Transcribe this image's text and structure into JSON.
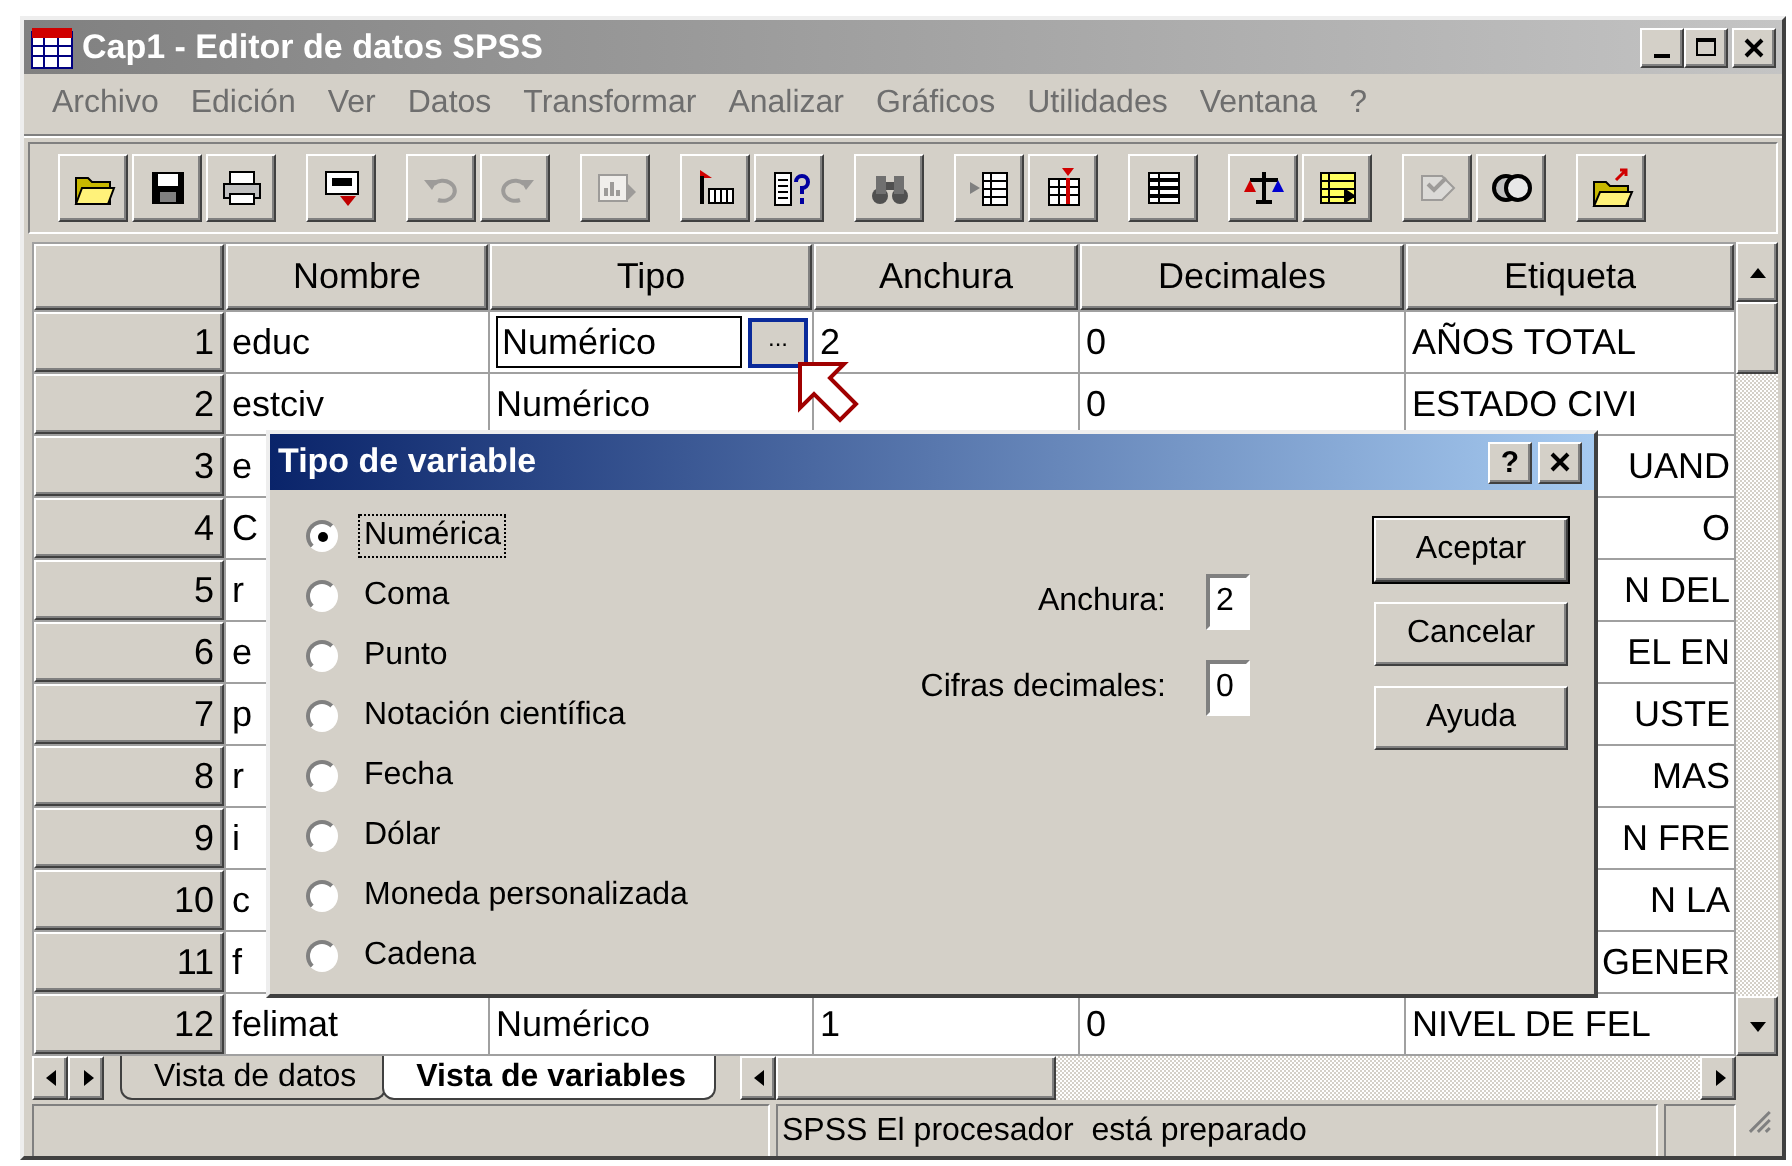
{
  "window": {
    "title": "Cap1 - Editor de datos SPSS"
  },
  "menu": [
    {
      "label": "Archivo"
    },
    {
      "label": "Edición"
    },
    {
      "label": "Ver"
    },
    {
      "label": "Datos"
    },
    {
      "label": "Transformar"
    },
    {
      "label": "Analizar"
    },
    {
      "label": "Gráficos"
    },
    {
      "label": "Utilidades"
    },
    {
      "label": "Ventana"
    },
    {
      "label": "?"
    }
  ],
  "toolbar": [
    [
      {
        "kind": "open",
        "disabled": false
      },
      {
        "kind": "save",
        "disabled": false
      },
      {
        "kind": "print",
        "disabled": false
      }
    ],
    [
      {
        "kind": "recall",
        "disabled": false
      }
    ],
    [
      {
        "kind": "undo",
        "disabled": true
      },
      {
        "kind": "redo",
        "disabled": true
      }
    ],
    [
      {
        "kind": "chart",
        "disabled": true
      }
    ],
    [
      {
        "kind": "gotocase",
        "disabled": false
      },
      {
        "kind": "varinfo",
        "disabled": false
      }
    ],
    [
      {
        "kind": "find",
        "disabled": false
      }
    ],
    [
      {
        "kind": "insertcase",
        "disabled": false
      },
      {
        "kind": "insertvar",
        "disabled": false
      }
    ],
    [
      {
        "kind": "split",
        "disabled": false
      }
    ],
    [
      {
        "kind": "weight",
        "disabled": false
      },
      {
        "kind": "select",
        "disabled": false
      }
    ],
    [
      {
        "kind": "labels",
        "disabled": true
      },
      {
        "kind": "sets",
        "disabled": false
      }
    ],
    [
      {
        "kind": "up",
        "disabled": false
      }
    ]
  ],
  "grid": {
    "columns": [
      "Nombre",
      "Tipo",
      "Anchura",
      "Decimales",
      "Etiqueta"
    ],
    "rows": [
      {
        "kind": "full",
        "number": "1",
        "nombre": "educ",
        "tipo": "Numérico",
        "editing": true,
        "editor_button": "...",
        "anchura": "2",
        "decimales": "0",
        "etiqueta": "AÑOS TOTAL"
      },
      {
        "kind": "full",
        "number": "2",
        "nombre": "estciv",
        "tipo": "Numérico",
        "editing": false,
        "decimales": "0",
        "etiqueta": "ESTADO CIVI"
      },
      {
        "kind": "covered",
        "number": "3",
        "nombre": "e",
        "etiqueta": "UAND"
      },
      {
        "kind": "covered",
        "number": "4",
        "nombre": "C",
        "etiqueta": "O"
      },
      {
        "kind": "covered",
        "number": "5",
        "nombre": "r",
        "etiqueta": "N DEL"
      },
      {
        "kind": "covered",
        "number": "6",
        "nombre": "e",
        "etiqueta": "EL EN"
      },
      {
        "kind": "covered",
        "number": "7",
        "nombre": "p",
        "etiqueta": "USTE"
      },
      {
        "kind": "covered",
        "number": "8",
        "nombre": "r",
        "etiqueta": "MAS"
      },
      {
        "kind": "covered",
        "number": "9",
        "nombre": "i",
        "etiqueta": "N FRE"
      },
      {
        "kind": "covered",
        "number": "10",
        "nombre": "c",
        "etiqueta": "N LA"
      },
      {
        "kind": "covered",
        "number": "11",
        "nombre": "f",
        "etiqueta": "GENER"
      },
      {
        "kind": "full",
        "number": "12",
        "nombre": "felimat",
        "tipo": "Numérico",
        "editing": false,
        "anchura": "1",
        "decimales": "0",
        "etiqueta": "NIVEL DE FEL"
      }
    ]
  },
  "dialog": {
    "title": "Tipo de variable",
    "help": "?",
    "options": [
      {
        "label": "Numérica",
        "selected": true,
        "focused": true
      },
      {
        "label": "Coma",
        "selected": false,
        "focused": false
      },
      {
        "label": "Punto",
        "selected": false,
        "focused": false
      },
      {
        "label": "Notación científica",
        "selected": false,
        "focused": false
      },
      {
        "label": "Fecha",
        "selected": false,
        "focused": false
      },
      {
        "label": "Dólar",
        "selected": false,
        "focused": false
      },
      {
        "label": "Moneda personalizada",
        "selected": false,
        "focused": false
      },
      {
        "label": "Cadena",
        "selected": false,
        "focused": false
      }
    ],
    "fields": [
      {
        "label": "Anchura:",
        "value": "2"
      },
      {
        "label": "Cifras decimales:",
        "value": "0"
      }
    ],
    "buttons": [
      {
        "label": "Aceptar",
        "default": true
      },
      {
        "label": "Cancelar",
        "default": false
      },
      {
        "label": "Ayuda",
        "default": false
      }
    ]
  },
  "tabs": [
    {
      "label": "Vista de datos",
      "selected": false
    },
    {
      "label": "Vista de variables",
      "selected": true
    }
  ],
  "status_bar": {
    "message": "SPSS El procesador  está preparado"
  }
}
